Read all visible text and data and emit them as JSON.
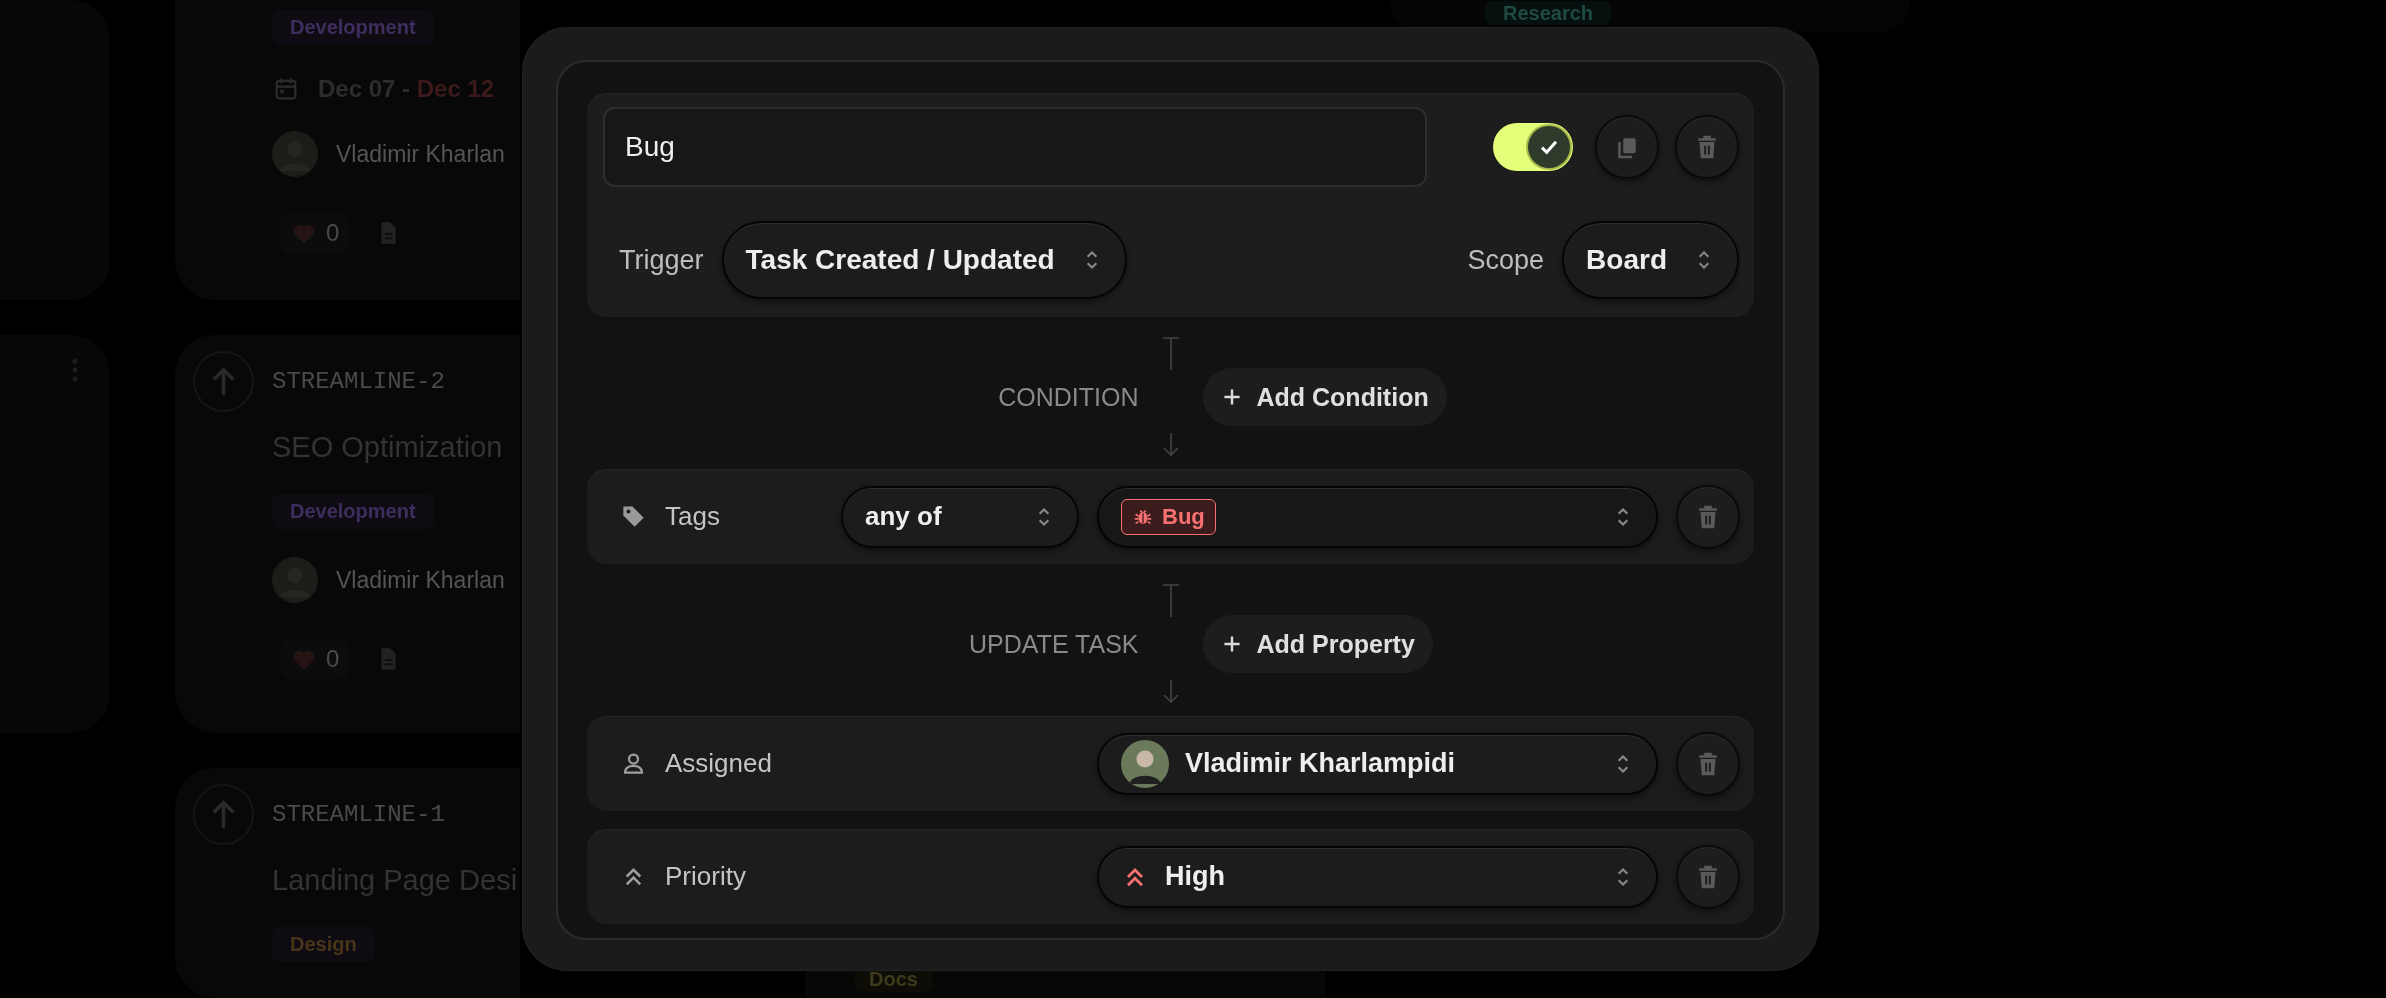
{
  "board": {
    "columns": [
      {
        "cards": [
          {
            "kind": "stub"
          },
          {
            "kind": "stub"
          }
        ]
      },
      {
        "cards": [
          {
            "kind": "task",
            "tag": {
              "label": "Development",
              "color": "#3f2d5e"
            },
            "date_start": "Dec 07",
            "date_separator": "-",
            "date_end": "Dec 12",
            "overdue": true,
            "assignee": "Vladimir Kharlan",
            "likes": "0"
          },
          {
            "kind": "task",
            "id": "STREAMLINE-2",
            "title": "SEO Optimization",
            "tag": {
              "label": "Development",
              "color": "#3f2d5e"
            },
            "assignee": "Vladimir Kharlan",
            "likes": "0"
          },
          {
            "kind": "task",
            "id": "STREAMLINE-1",
            "title": "Landing Page Desi",
            "tag": {
              "label": "Design",
              "color": "#4a3418"
            }
          }
        ]
      },
      {
        "cards": [
          {
            "kind": "tag_only",
            "tag": {
              "label": "Docs",
              "color": "#3e3a1c"
            }
          }
        ]
      },
      {
        "cards": [
          {
            "kind": "tag_only",
            "tag": {
              "label": "Research",
              "color": "#1f4a44"
            }
          }
        ]
      }
    ]
  },
  "rule": {
    "name": "Bug",
    "enabled": true,
    "trigger": {
      "label": "Trigger",
      "value": "Task Created / Updated"
    },
    "scope": {
      "label": "Scope",
      "value": "Board"
    },
    "condition_section": {
      "label": "CONDITION",
      "add_button": "Add Condition"
    },
    "conditions": [
      {
        "kind": "tags",
        "field": "Tags",
        "operator": "any of",
        "values": [
          {
            "label": "Bug",
            "color": "#f87171"
          }
        ]
      }
    ],
    "update_section": {
      "label": "UPDATE TASK",
      "add_button": "Add Property"
    },
    "updates": [
      {
        "kind": "assignee",
        "field": "Assigned",
        "value": "Vladimir Kharlampidi"
      },
      {
        "kind": "priority",
        "field": "Priority",
        "value": "High"
      }
    ]
  }
}
